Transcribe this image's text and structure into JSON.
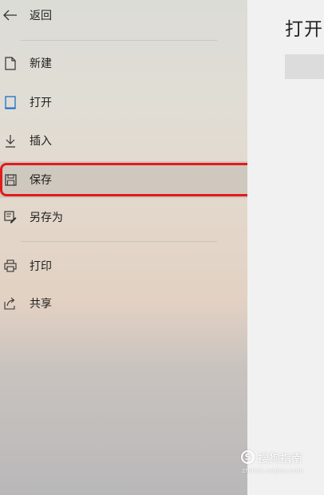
{
  "sidebar": {
    "back": {
      "label": "返回",
      "icon": "arrow-left-icon"
    },
    "items": [
      {
        "id": "new",
        "label": "新建",
        "icon": "new-document-icon"
      },
      {
        "id": "open",
        "label": "打开",
        "icon": "open-document-icon"
      },
      {
        "id": "insert",
        "label": "插入",
        "icon": "insert-down-arrow-icon"
      },
      {
        "id": "save",
        "label": "保存",
        "icon": "save-floppy-icon",
        "selected": true
      },
      {
        "id": "saveas",
        "label": "另存为",
        "icon": "save-as-icon"
      },
      {
        "id": "print",
        "label": "打印",
        "icon": "printer-icon"
      },
      {
        "id": "share",
        "label": "共享",
        "icon": "share-icon"
      }
    ]
  },
  "content": {
    "title": "打开"
  },
  "watermark": {
    "logo_letter": "S",
    "name": "搜狗指南",
    "url": "zhinan.sogou.com"
  },
  "colors": {
    "highlight": "#e21b1b",
    "open_icon_accent": "#1a6fc9"
  }
}
